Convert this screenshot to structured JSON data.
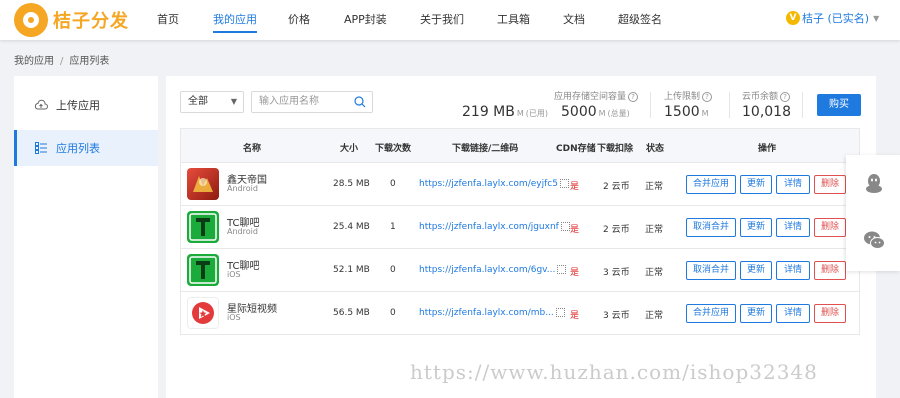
{
  "brand": {
    "name": "桔子分发",
    "color": "#f5a623"
  },
  "nav": {
    "items": [
      "首页",
      "我的应用",
      "价格",
      "APP封装",
      "关于我们",
      "工具箱",
      "文档",
      "超级签名"
    ],
    "active": "我的应用"
  },
  "user": {
    "badge": "V",
    "name": "桔子 (已实名)"
  },
  "breadcrumb": {
    "first": "我的应用",
    "sep": "/",
    "second": "应用列表"
  },
  "sidebar": {
    "items": [
      {
        "label": "上传应用",
        "icon": "cloud-upload-icon"
      },
      {
        "label": "应用列表",
        "icon": "list-icon"
      }
    ],
    "active": "应用列表"
  },
  "filters": {
    "platform": "全部",
    "search_placeholder": "输入应用名称"
  },
  "stats": {
    "storage_label": "应用存储空间容量",
    "used_value": "219 MB",
    "used_suffix": "(已用)",
    "total_value": "5000",
    "total_suffix": "(总量)",
    "upload_label": "上传限制",
    "upload_value": "1500",
    "unit_m": "M",
    "coins_label": "云币余额",
    "coins_value": "10,018",
    "buy_label": "购买"
  },
  "table": {
    "headers": [
      "名称",
      "大小",
      "下载次数",
      "下载链接/二维码",
      "CDN存储",
      "下载扣除",
      "状态",
      "操作"
    ],
    "rows": [
      {
        "name": "鑫天帝国",
        "os": "Android",
        "size": "28.5 MB",
        "downloads": "0",
        "link": "https://jzfenfa.laylx.com/eyjfc5",
        "cdn": "是",
        "deduct": "2 云币",
        "status": "正常",
        "merge": "合并应用",
        "update": "更新",
        "detail": "详情",
        "delete": "删除",
        "icon_color": "#c0392b"
      },
      {
        "name": "TC聊吧",
        "os": "Android",
        "size": "25.4 MB",
        "downloads": "1",
        "link": "https://jzfenfa.laylx.com/jguxnf",
        "cdn": "是",
        "deduct": "2 云币",
        "status": "正常",
        "merge": "取消合并",
        "update": "更新",
        "detail": "详情",
        "delete": "删除",
        "icon_color": "#1aab3b"
      },
      {
        "name": "TC聊吧",
        "os": "iOS",
        "size": "52.1 MB",
        "downloads": "0",
        "link": "https://jzfenfa.laylx.com/6gv...",
        "cdn": "是",
        "deduct": "3 云币",
        "status": "正常",
        "merge": "取消合并",
        "update": "更新",
        "detail": "详情",
        "delete": "删除",
        "icon_color": "#1aab3b"
      },
      {
        "name": "星际短视频",
        "os": "iOS",
        "size": "56.5 MB",
        "downloads": "0",
        "link": "https://jzfenfa.laylx.com/mb...",
        "cdn": "是",
        "deduct": "3 云币",
        "status": "正常",
        "merge": "合并应用",
        "update": "更新",
        "detail": "详情",
        "delete": "删除",
        "icon_color": "#e33b3b"
      }
    ]
  },
  "float_panel": {
    "icons": [
      "qq-icon",
      "wechat-icon"
    ]
  },
  "watermark": "https://www.huzhan.com/ishop32348",
  "colors": {
    "accent": "#1f7ae0",
    "danger": "#e05050"
  }
}
